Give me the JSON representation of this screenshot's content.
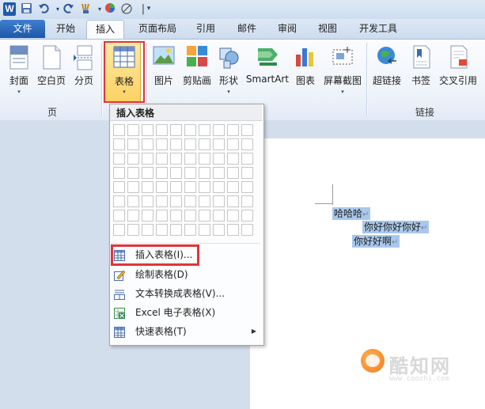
{
  "quick_access": {
    "logo_letter": "W",
    "icons": [
      "save-icon",
      "undo-icon",
      "redo-icon",
      "format-painter-icon",
      "color-icon",
      "clear-format-icon",
      "customize-icon"
    ]
  },
  "tabs": [
    {
      "label": "文件"
    },
    {
      "label": "开始"
    },
    {
      "label": "插入",
      "active": true
    },
    {
      "label": "页面布局"
    },
    {
      "label": "引用"
    },
    {
      "label": "邮件"
    },
    {
      "label": "审阅"
    },
    {
      "label": "视图"
    },
    {
      "label": "开发工具"
    }
  ],
  "ribbon": {
    "pages_group": {
      "label": "页",
      "buttons": [
        "封面",
        "空白页",
        "分页"
      ]
    },
    "table_button": {
      "label": "表格"
    },
    "illustrations": [
      "图片",
      "剪贴画",
      "形状",
      "SmartArt",
      "图表",
      "屏幕截图"
    ],
    "links_group": {
      "label": "链接",
      "buttons": [
        "超链接",
        "书签",
        "交叉引用"
      ]
    }
  },
  "dropdown": {
    "header": "插入表格",
    "grid": {
      "cols": 10,
      "rows": 8
    },
    "menu_items": [
      {
        "label": "插入表格(I)...",
        "highlighted": true
      },
      {
        "label": "绘制表格(D)"
      },
      {
        "label": "文本转换成表格(V)..."
      },
      {
        "label": "Excel 电子表格(X)"
      },
      {
        "label": "快速表格(T)",
        "has_submenu": true
      }
    ]
  },
  "document": {
    "lines": [
      "哈哈哈",
      "你好你好你好",
      "你好好啊"
    ],
    "return_mark": "↵"
  },
  "watermark": {
    "brand": "酷知网",
    "url": "www.coozhi.com"
  },
  "colors": {
    "highlight_box": "#e0353a",
    "selection": "#a9c8ec",
    "file_tab": "#2a63b5"
  }
}
